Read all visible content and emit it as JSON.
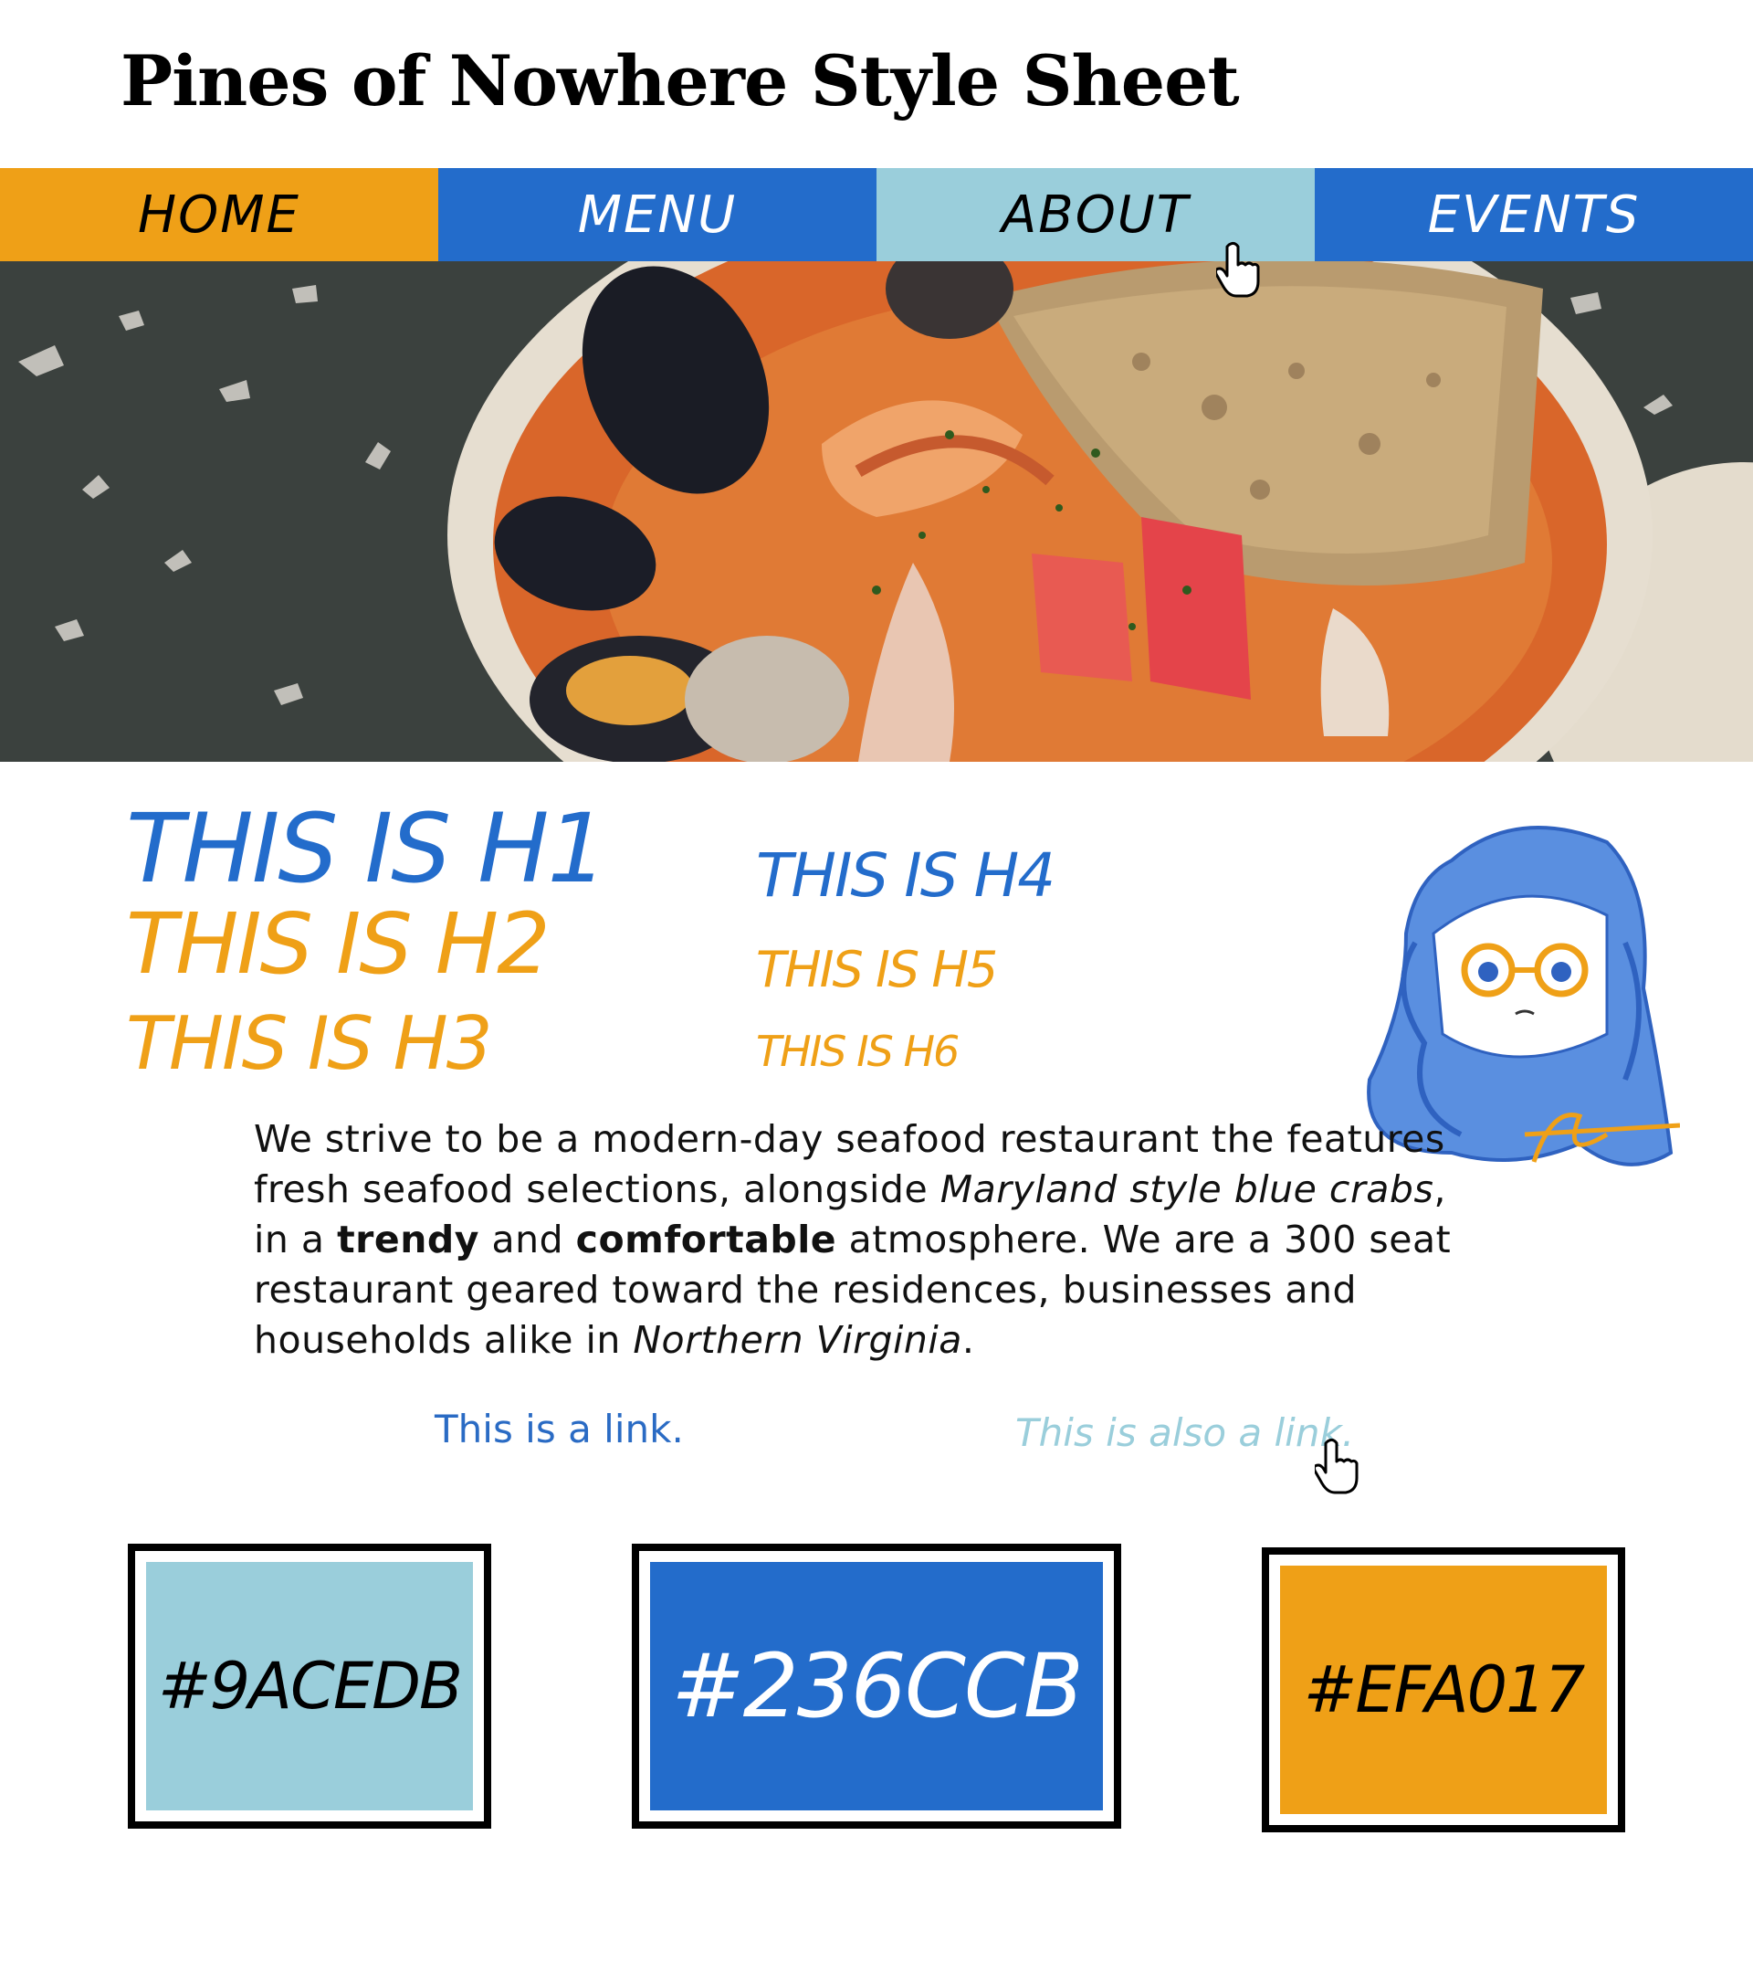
{
  "header": {
    "title": "Pines of Nowhere Style Sheet"
  },
  "nav": {
    "items": [
      {
        "label": "HOME",
        "bg": "#EFA017"
      },
      {
        "label": "MENU",
        "bg": "#236CCB"
      },
      {
        "label": "ABOUT",
        "bg": "#9ACEDB"
      },
      {
        "label": "EVENTS",
        "bg": "#236CCB"
      }
    ]
  },
  "hero": {
    "icon": "seafood-stew-photo"
  },
  "headings": {
    "h1": "THIS IS H1",
    "h2": "THIS IS H2",
    "h3": "THIS IS H3",
    "h4": "THIS IS H4",
    "h5": "THIS IS H5",
    "h6": "THIS IS H6"
  },
  "intro": {
    "t1": "We strive to be a modern-day seafood restaurant the features fresh seafood selections, alongside ",
    "em1": "Maryland style blue crabs",
    "t2": ", in a ",
    "b1": "trendy",
    "t3": " and ",
    "b2": "comfortable",
    "t4": " atmosphere. We are a 300 seat restaurant geared toward the residences, businesses and households alike in ",
    "em2": "Northern Virginia",
    "t5": "."
  },
  "links": {
    "link1": "This is a link.",
    "link2": "This is also a link."
  },
  "swatches": [
    {
      "label": "#9ACEDB",
      "color": "#9ACEDB",
      "text_color": "#000000"
    },
    {
      "label": "#236CCB",
      "color": "#236CCB",
      "text_color": "#ffffff"
    },
    {
      "label": "#EFA017",
      "color": "#EFA017",
      "text_color": "#000000"
    }
  ]
}
